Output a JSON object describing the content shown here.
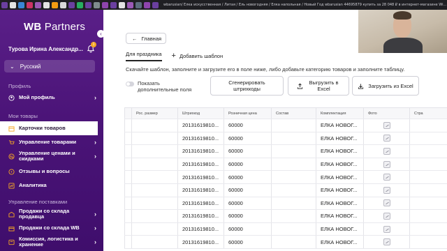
{
  "browser": {
    "tab_text": "wbarusian/ Елка искусственная / Литая / Ель новогодняя / Елка напольная / Новый Год wbarusian 44695879 купить за 28 048 ₽ в интернет-магазине Wi..."
  },
  "sidebar": {
    "logo_main": "WB",
    "logo_sub": "Partners",
    "user_name": "Турова Ирина Александр...",
    "notif_count": "1",
    "language": "Русский",
    "section_profile": "Профиль",
    "section_goods": "Мои товары",
    "section_supply": "Управление поставками",
    "items": [
      {
        "label": "Мой профиль",
        "icon": "user-icon"
      },
      {
        "label": "Карточки товаров",
        "icon": "box-icon"
      },
      {
        "label": "Управление товарами",
        "icon": "cart-icon"
      },
      {
        "label": "Управление ценами и скидками",
        "icon": "price-icon"
      },
      {
        "label": "Отзывы и вопросы",
        "icon": "chat-icon"
      },
      {
        "label": "Аналитика",
        "icon": "analytics-icon"
      },
      {
        "label": "Продажи со склада продавца",
        "icon": "warehouse-icon"
      },
      {
        "label": "Продажи со склада WB",
        "icon": "wb-warehouse-icon"
      },
      {
        "label": "Комиссия, логистика и хранение",
        "icon": "commission-icon"
      }
    ]
  },
  "main": {
    "back_label": "Главная",
    "tab_active": "Для праздника",
    "tab_add": "Добавить шаблон",
    "hint": "Скачайте шаблон, заполните и загрузите его в поле ниже, либо добавьте категорию товаров и заполните таблицу.",
    "toggle_label": "Показать дополнительные поля",
    "btn_generate": "Сгенерировать штрихкоды",
    "btn_export": "Выгрузить в Excel",
    "btn_import": "Загрузить из Excel"
  },
  "table": {
    "columns": [
      "Рос. размер",
      "Штрихкод",
      "Розничная цена",
      "Состав",
      "Комплектация",
      "Фото",
      "Стра"
    ],
    "rows": [
      [
        "",
        "20131619810...",
        "60000",
        "",
        "ЕЛКА НОВОГ..."
      ],
      [
        "",
        "20131619810...",
        "60000",
        "",
        "ЕЛКА НОВОГ..."
      ],
      [
        "",
        "20131619810...",
        "60000",
        "",
        "ЕЛКА НОВОГ..."
      ],
      [
        "",
        "20131619810...",
        "60000",
        "",
        "ЕЛКА НОВОГ..."
      ],
      [
        "",
        "20131619810...",
        "60000",
        "",
        "ЕЛКА НОВОГ..."
      ],
      [
        "",
        "20131619810...",
        "60000",
        "",
        "ЕЛКА НОВОГ..."
      ],
      [
        "",
        "20131619810...",
        "60000",
        "",
        "ЕЛКА НОВОГ..."
      ],
      [
        "",
        "20131619810...",
        "60000",
        "",
        "ЕЛКА НОВОГ..."
      ],
      [
        "",
        "20131619810...",
        "60000",
        "",
        "ЕЛКА НОВОГ..."
      ],
      [
        "",
        "20131619810...",
        "60000",
        "",
        "ЕЛКА НОВОГ..."
      ]
    ]
  },
  "colors": {
    "sidebar": "#4b1478",
    "accent": "#f5a623"
  }
}
